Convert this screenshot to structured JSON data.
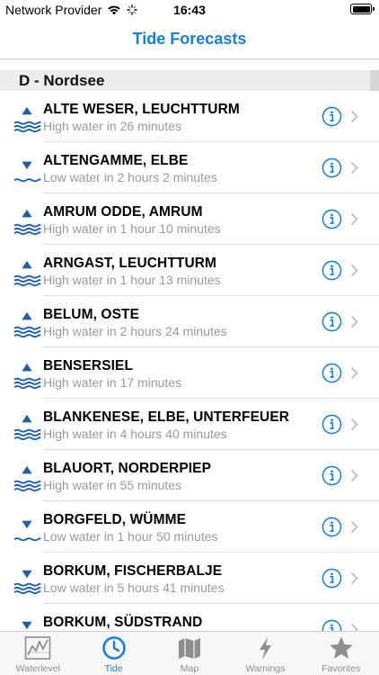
{
  "status_bar": {
    "carrier": "Network Provider",
    "time": "16:43"
  },
  "nav": {
    "title": "Tide Forecasts"
  },
  "section": {
    "title": "D - Nordsee"
  },
  "colors": {
    "accent": "#1a7fd4",
    "tide_icon": "#1f5fa8",
    "subtitle": "#9a9a9a"
  },
  "stations": [
    {
      "name": "ALTE WESER, LEUCHTTURM",
      "status": "High water in 26 minutes",
      "tide": "high"
    },
    {
      "name": "ALTENGAMME, ELBE",
      "status": "Low water in 2 hours 2 minutes",
      "tide": "low"
    },
    {
      "name": "AMRUM ODDE, AMRUM",
      "status": "High water in 1 hour 10 minutes",
      "tide": "high"
    },
    {
      "name": "ARNGAST, LEUCHTTURM",
      "status": "High water in 1 hour 13 minutes",
      "tide": "high"
    },
    {
      "name": "BELUM, OSTE",
      "status": "High water in 2 hours 24 minutes",
      "tide": "high"
    },
    {
      "name": "BENSERSIEL",
      "status": "High water in 17 minutes",
      "tide": "high"
    },
    {
      "name": "BLANKENESE, ELBE, UNTERFEUER",
      "status": "High water in 4 hours 40 minutes",
      "tide": "high"
    },
    {
      "name": "BLAUORT, NORDERPIEP",
      "status": "High water in 55 minutes",
      "tide": "high"
    },
    {
      "name": "BORGFELD, WÜMME",
      "status": "Low water in 1 hour 50 minutes",
      "tide": "low"
    },
    {
      "name": "BORKUM, FISCHERBALJE",
      "status": "Low water in 5 hours 41 minutes",
      "tide": "low-high"
    },
    {
      "name": "BORKUM, SÜDSTRAND",
      "status": "",
      "tide": "low-high"
    }
  ],
  "tabs": [
    {
      "label": "Waterlevel",
      "icon": "chart-icon",
      "active": false
    },
    {
      "label": "Tide",
      "icon": "clock-icon",
      "active": true
    },
    {
      "label": "Map",
      "icon": "map-icon",
      "active": false
    },
    {
      "label": "Warnings",
      "icon": "lightning-icon",
      "active": false
    },
    {
      "label": "Favorites",
      "icon": "star-icon",
      "active": false
    }
  ]
}
